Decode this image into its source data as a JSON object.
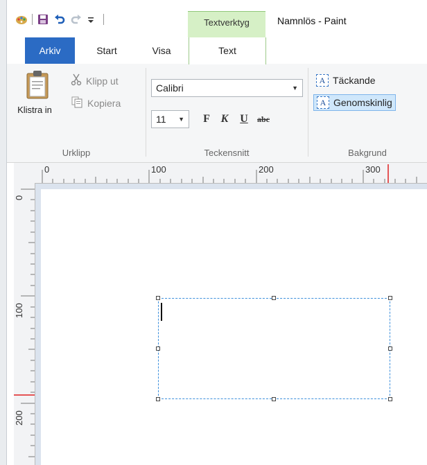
{
  "titlebar": {
    "context_tab": "Textverktyg",
    "window_title": "Namnlös - Paint"
  },
  "tabs": {
    "file": "Arkiv",
    "start": "Start",
    "view": "Visa",
    "text": "Text"
  },
  "ribbon": {
    "clipboard": {
      "paste_label": "Klistra in",
      "cut_label": "Klipp ut",
      "copy_label": "Kopiera",
      "group_label": "Urklipp"
    },
    "font": {
      "family": "Calibri",
      "size": "11",
      "bold": "F",
      "italic": "K",
      "underline": "U",
      "strike": "abc",
      "group_label": "Teckensnitt"
    },
    "background": {
      "opaque_label": "Täckande",
      "transparent_label": "Genomskinlig",
      "group_label": "Bakgrund"
    }
  },
  "rulers": {
    "h_labels": [
      "0",
      "100",
      "200",
      "300"
    ],
    "v_labels": [
      "0",
      "100",
      "200"
    ]
  },
  "colors": {
    "file_tab": "#2b6bc4",
    "context_tab": "#d6f0c6",
    "selection_border": "#3b8fdc",
    "active_button": "#cfe7fb"
  }
}
